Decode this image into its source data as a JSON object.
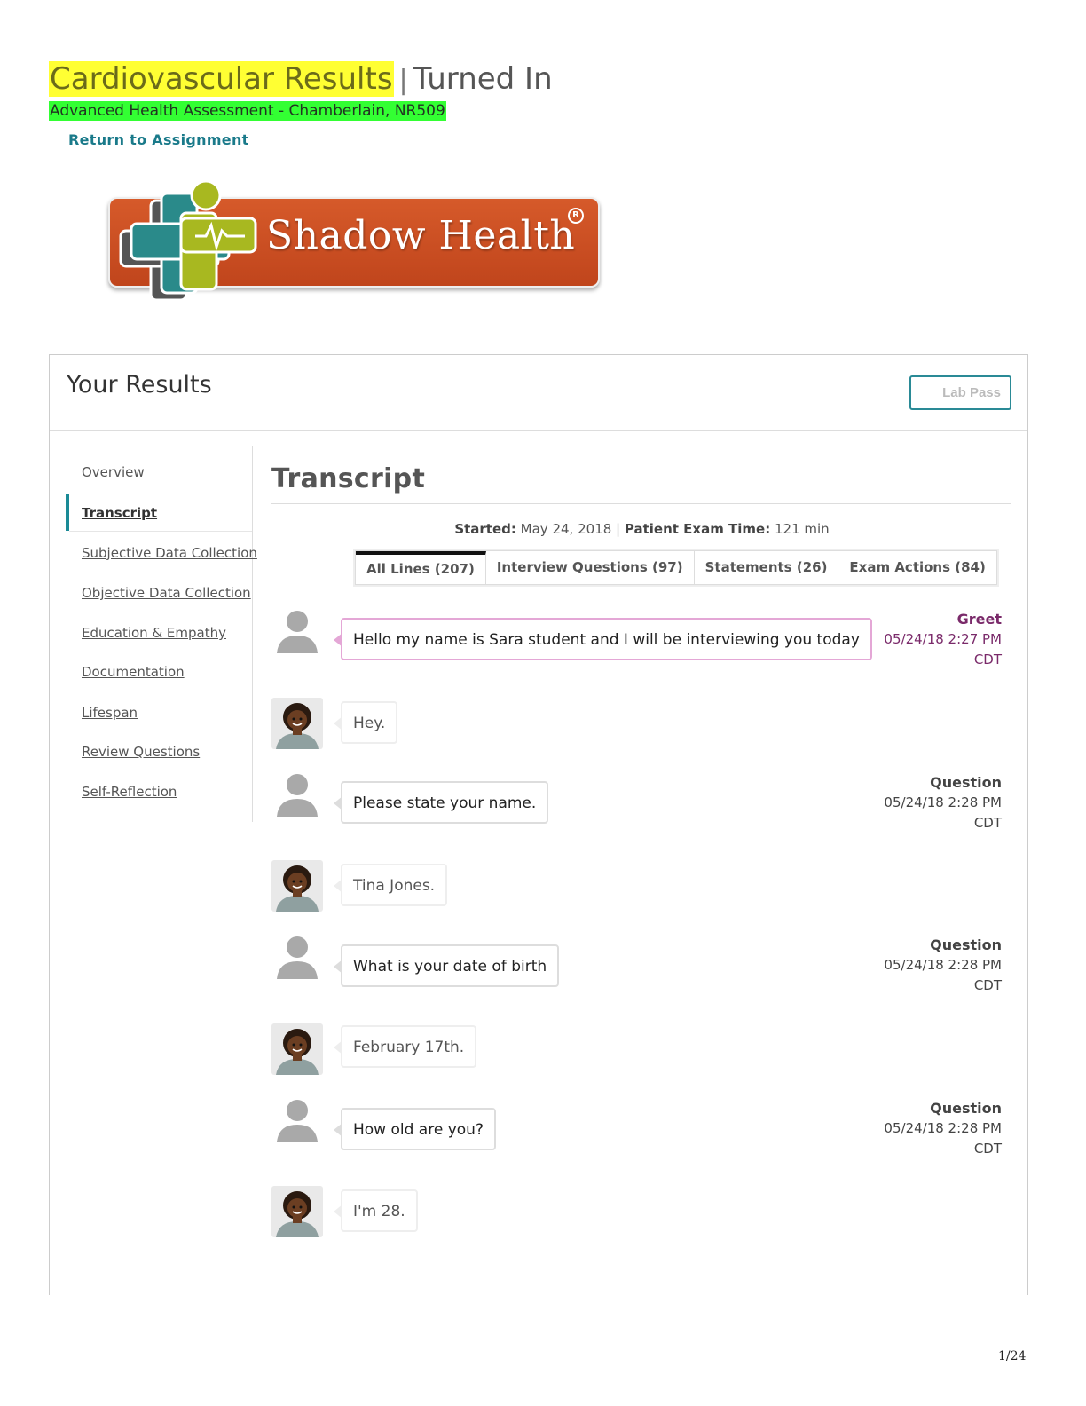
{
  "header": {
    "title_main": "Cardiovascular Results",
    "title_sep": "|",
    "title_status": "Turned In",
    "subtitle": "Advanced Health Assessment - Chamberlain, NR509",
    "return_link": "Return to Assignment"
  },
  "logo": {
    "text": "Shadow Health",
    "reg": "R"
  },
  "panel": {
    "title": "Your Results",
    "lab_pass": "Lab Pass"
  },
  "sidebar": {
    "items": [
      {
        "label": "Overview"
      },
      {
        "label": "Transcript"
      },
      {
        "label": "Subjective Data Collection"
      },
      {
        "label": "Objective Data Collection"
      },
      {
        "label": "Education & Empathy"
      },
      {
        "label": "Documentation"
      },
      {
        "label": "Lifespan"
      },
      {
        "label": "Review Questions"
      },
      {
        "label": "Self-Reflection"
      }
    ],
    "active": "Transcript"
  },
  "main": {
    "title": "Transcript",
    "started_label": "Started:",
    "started_value": "May 24, 2018",
    "meta_sep": "|",
    "exam_time_label": "Patient Exam Time:",
    "exam_time_value": "121 min",
    "tabs": [
      {
        "label": "All Lines (207)"
      },
      {
        "label": "Interview Questions (97)"
      },
      {
        "label": "Statements (26)"
      },
      {
        "label": "Exam Actions (84)"
      }
    ]
  },
  "transcript": [
    {
      "speaker": "student",
      "text": "Hello my name is Sara student and I will be interviewing you today",
      "kind": "Greet",
      "date": "05/24/18 2:27 PM",
      "tz": "CDT"
    },
    {
      "speaker": "patient",
      "text": "Hey."
    },
    {
      "speaker": "student",
      "text": "Please state your name.",
      "kind": "Question",
      "date": "05/24/18 2:28 PM",
      "tz": "CDT"
    },
    {
      "speaker": "patient",
      "text": "Tina Jones."
    },
    {
      "speaker": "student",
      "text": "What is your date of birth",
      "kind": "Question",
      "date": "05/24/18 2:28 PM",
      "tz": "CDT"
    },
    {
      "speaker": "patient",
      "text": "February 17th."
    },
    {
      "speaker": "student",
      "text": "How old are you?",
      "kind": "Question",
      "date": "05/24/18 2:28 PM",
      "tz": "CDT"
    },
    {
      "speaker": "patient",
      "text": "I'm 28."
    }
  ],
  "footer": {
    "page": "1/24"
  },
  "colors": {
    "accent": "#1a8a96",
    "greet": "#7a2a6a",
    "highlight_yellow": "#ffff33",
    "highlight_green": "#33ff33",
    "logo_orange": "#c0451c"
  }
}
